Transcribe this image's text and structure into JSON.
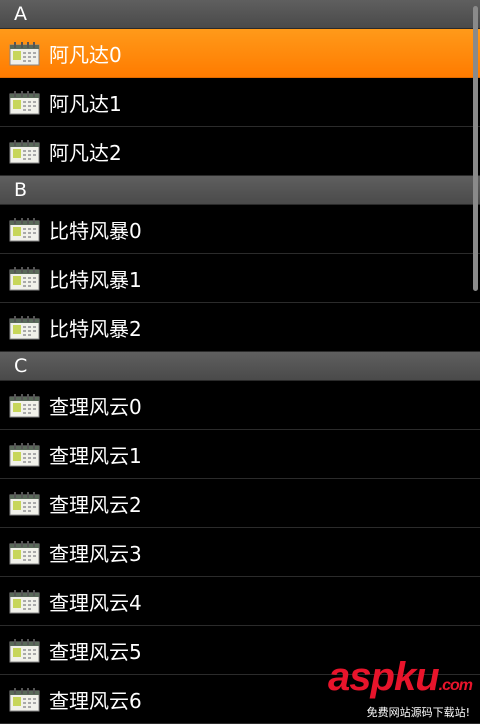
{
  "sections": [
    {
      "header": "A",
      "items": [
        "阿凡达0",
        "阿凡达1",
        "阿凡达2"
      ]
    },
    {
      "header": "B",
      "items": [
        "比特风暴0",
        "比特风暴1",
        "比特风暴2"
      ]
    },
    {
      "header": "C",
      "items": [
        "查理风云0",
        "查理风云1",
        "查理风云2",
        "查理风云3",
        "查理风云4",
        "查理风云5",
        "查理风云6"
      ]
    }
  ],
  "selected_item": "阿凡达0",
  "colors": {
    "selected": "#ff8a00",
    "header": "#505050",
    "background": "#000000",
    "watermark": "#e8142b"
  },
  "icon_name": "calendar-icon",
  "watermark": {
    "main": "aspku",
    "suffix": ".com",
    "sub": "免费网站源码下载站!"
  }
}
